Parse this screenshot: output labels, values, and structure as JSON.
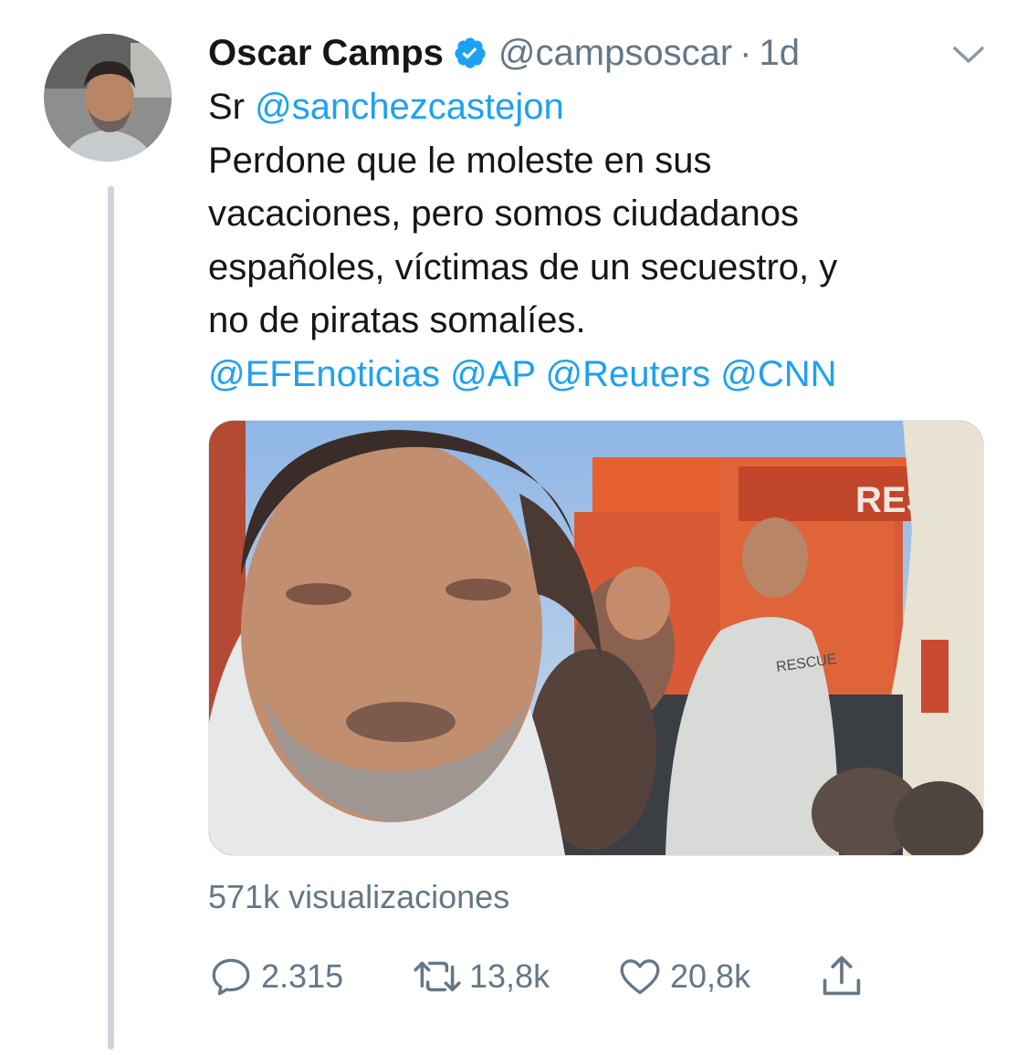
{
  "tweet": {
    "author_name": "Oscar Camps",
    "handle": "@campsoscar",
    "separator": "·",
    "time": "1d",
    "text_lines": [
      [
        {
          "text": "Sr ",
          "mention": false
        },
        {
          "text": "@sanchezcastejon",
          "mention": true
        }
      ],
      [
        {
          "text": "Perdone que le moleste en sus",
          "mention": false
        }
      ],
      [
        {
          "text": "vacaciones, pero somos ciudadanos",
          "mention": false
        }
      ],
      [
        {
          "text": "españoles, víctimas de un secuestro, y",
          "mention": false
        }
      ],
      [
        {
          "text": "no de piratas somalíes.",
          "mention": false
        }
      ],
      [
        {
          "text": "@EFEnoticias @AP @Reuters @CNN",
          "mention": true
        }
      ]
    ],
    "media": {
      "sign_text": "RES",
      "shirt_text": "RESCUE"
    },
    "views": "571k visualizaciones",
    "actions": {
      "reply_count": "2.315",
      "retweet_count": "13,8k",
      "like_count": "20,8k"
    }
  },
  "icons": {
    "verified": "verified-badge-icon",
    "chevron": "chevron-down-icon",
    "reply": "reply-icon",
    "retweet": "retweet-icon",
    "like": "heart-icon",
    "share": "share-icon"
  },
  "colors": {
    "link": "#1da1f2",
    "secondary_text": "#657786",
    "primary_text": "#14171a",
    "thread_line": "#ccd6dd"
  }
}
